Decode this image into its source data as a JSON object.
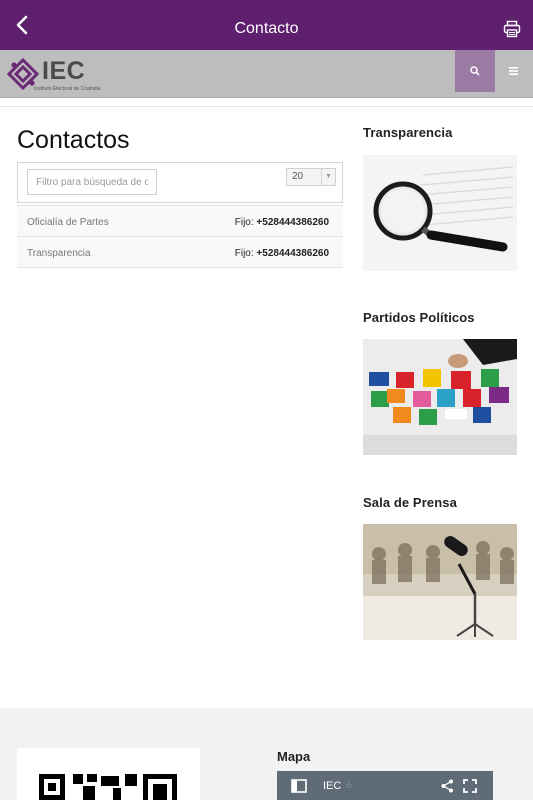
{
  "topbar": {
    "title": "Contacto"
  },
  "header": {
    "logo_text": "IEC",
    "logo_subtitle": "Instituto Electoral de Coahuila"
  },
  "main": {
    "title": "Contactos",
    "filter_placeholder": "Filtro para búsqueda de c",
    "page_size": "20",
    "contacts": [
      {
        "name": "Oficialía de Partes",
        "phone_label": "Fijo:",
        "phone": "+528444386260"
      },
      {
        "name": "Transparencia",
        "phone_label": "Fijo:",
        "phone": "+528444386260"
      }
    ]
  },
  "sidebar": {
    "sections": [
      {
        "title": "Transparencia"
      },
      {
        "title": "Partidos Políticos"
      },
      {
        "title": "Sala de Prensa"
      }
    ]
  },
  "footer": {
    "map_label": "Mapa",
    "map_name": "IEC"
  },
  "colors": {
    "brand": "#5d1f6e",
    "accent": "#9b7ba4"
  }
}
